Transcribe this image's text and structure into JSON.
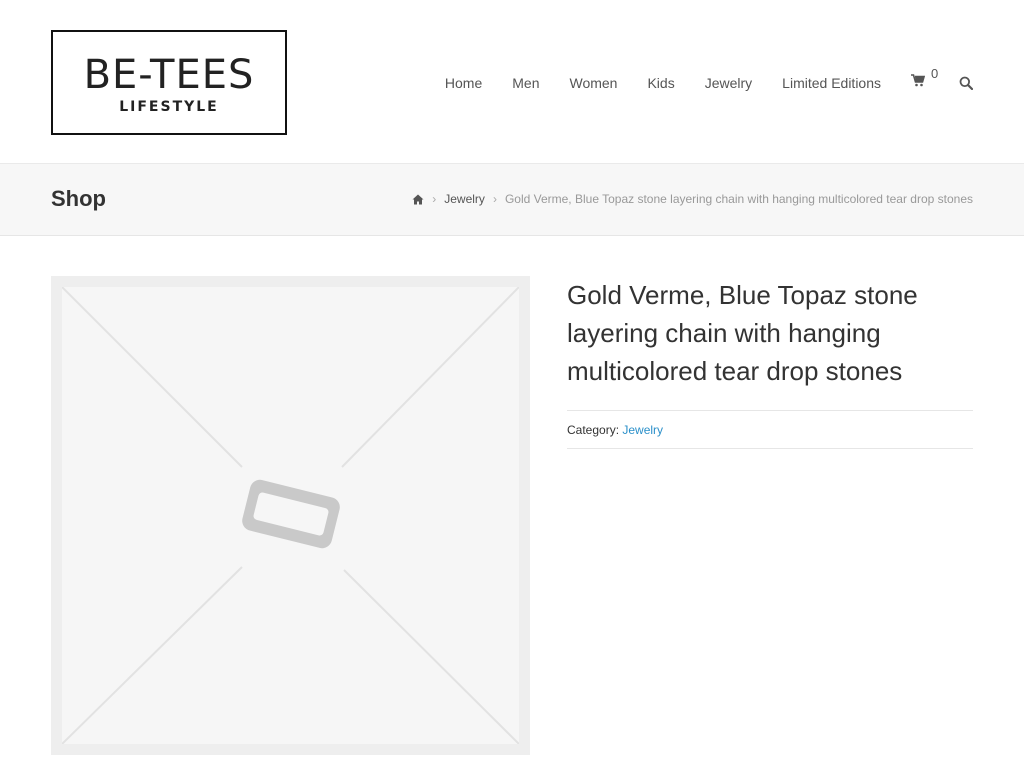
{
  "logo": {
    "main": "BE-TEES",
    "sub": "LIFESTYLE"
  },
  "nav": {
    "items": [
      "Home",
      "Men",
      "Women",
      "Kids",
      "Jewelry",
      "Limited Editions"
    ],
    "cart_count": "0",
    "icons": {
      "cart": "shopping-cart-icon",
      "search": "search-icon"
    }
  },
  "titlebar": {
    "title": "Shop",
    "breadcrumb": {
      "home_icon": "home-icon",
      "category": "Jewelry",
      "current": "Gold Verme, Blue Topaz stone layering chain with hanging multicolored tear drop stones"
    }
  },
  "product": {
    "title": "Gold Verme, Blue Topaz stone layering chain with hanging multicolored tear drop stones",
    "image_icon": "placeholder-image-icon",
    "meta": {
      "category_label": "Category:",
      "category_value": "Jewelry"
    }
  },
  "colors": {
    "accent_link": "#2a8fc9",
    "titlebar_bg": "#f7f7f7"
  }
}
